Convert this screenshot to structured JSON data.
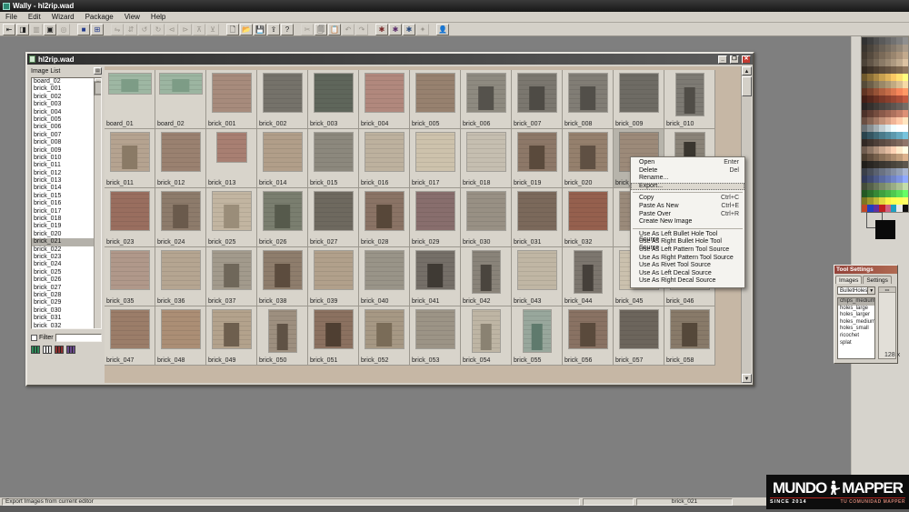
{
  "window": {
    "title": "Wally - hl2rip.wad"
  },
  "menu": {
    "items": [
      "File",
      "Edit",
      "Wizard",
      "Package",
      "View",
      "Help"
    ]
  },
  "toolbar": {
    "groups": [
      [
        {
          "name": "view-list-icon",
          "g": "⇤",
          "en": 1
        },
        {
          "name": "view-thumbs-icon",
          "g": "◨",
          "en": 1
        },
        {
          "name": "view-detail-icon",
          "g": "▥",
          "en": 0
        },
        {
          "name": "view-image-icon",
          "g": "▣",
          "en": 1
        },
        {
          "name": "view-mask-icon",
          "g": "◎",
          "en": 0
        }
      ],
      [
        {
          "name": "palette-view-icon",
          "g": "■",
          "en": 1,
          "c": "#223a8c"
        },
        {
          "name": "grid-view-icon",
          "g": "⊞",
          "en": 1,
          "c": "#223a8c"
        }
      ],
      [
        {
          "name": "flip-h-icon",
          "g": "⇋",
          "en": 0
        },
        {
          "name": "flip-v-icon",
          "g": "⇵",
          "en": 0
        },
        {
          "name": "rotate-l-icon",
          "g": "↺",
          "en": 0
        },
        {
          "name": "rotate-r-icon",
          "g": "↻",
          "en": 0
        },
        {
          "name": "shift-l-icon",
          "g": "⊲",
          "en": 0
        },
        {
          "name": "shift-r-icon",
          "g": "⊳",
          "en": 0
        },
        {
          "name": "shift-u-icon",
          "g": "⊼",
          "en": 0
        },
        {
          "name": "shift-d-icon",
          "g": "⊻",
          "en": 0
        }
      ],
      [
        {
          "name": "new-icon",
          "g": "🗋",
          "en": 1
        },
        {
          "name": "open-icon",
          "g": "📂",
          "en": 1,
          "c": "#a07a10"
        },
        {
          "name": "save-icon",
          "g": "💾",
          "en": 1,
          "c": "#223a8c"
        },
        {
          "name": "import-icon",
          "g": "⇪",
          "en": 1
        },
        {
          "name": "help-icon",
          "g": "?",
          "en": 1
        }
      ],
      [
        {
          "name": "cut-icon",
          "g": "✂",
          "en": 0
        },
        {
          "name": "copy-icon",
          "g": "🗐",
          "en": 1
        },
        {
          "name": "paste-icon",
          "g": "📋",
          "en": 1
        },
        {
          "name": "undo-icon",
          "g": "↶",
          "en": 0
        },
        {
          "name": "redo-icon",
          "g": "↷",
          "en": 0
        }
      ],
      [
        {
          "name": "bullethole-left-icon",
          "g": "✱",
          "en": 1,
          "c": "#7a2a2a"
        },
        {
          "name": "bullethole-right-icon",
          "g": "✱",
          "en": 1,
          "c": "#5a2a6a"
        },
        {
          "name": "decal-tool-icon",
          "g": "✱",
          "en": 1,
          "c": "#2a4a7a"
        },
        {
          "name": "rivet-tool-icon",
          "g": "✦",
          "en": 0
        }
      ],
      [
        {
          "name": "user-icon",
          "g": "👤",
          "en": 1
        }
      ]
    ]
  },
  "child_window": {
    "title": "hl2rip.wad",
    "buttons": {
      "minimize": "_",
      "restore": "❐",
      "close": "✕"
    }
  },
  "image_list": {
    "label": "Image List",
    "selected": "brick_021",
    "filter_label": "Filter",
    "items": [
      "board_02",
      "brick_001",
      "brick_002",
      "brick_003",
      "brick_004",
      "brick_005",
      "brick_006",
      "brick_007",
      "brick_008",
      "brick_009",
      "brick_010",
      "brick_011",
      "brick_012",
      "brick_013",
      "brick_014",
      "brick_015",
      "brick_016",
      "brick_017",
      "brick_018",
      "brick_019",
      "brick_020",
      "brick_021",
      "brick_022",
      "brick_023",
      "brick_024",
      "brick_025",
      "brick_026",
      "brick_027",
      "brick_028",
      "brick_029",
      "brick_030",
      "brick_031",
      "brick_032"
    ],
    "wad_icon_colors": [
      "#2e8b5a",
      "#e8e8e8",
      "#8b2e2e",
      "#6a4a8b"
    ]
  },
  "texture_grid": {
    "rows": [
      [
        {
          "label": "board_01",
          "c": "#9eb7a3",
          "d": "#7d9c86",
          "s": "w"
        },
        {
          "label": "board_02",
          "c": "#9cb5a1",
          "d": "#7d9c86",
          "s": "w"
        },
        {
          "label": "brick_001",
          "c": "#a78b7c",
          "s": "q"
        },
        {
          "label": "brick_002",
          "c": "#75726a",
          "s": "q"
        },
        {
          "label": "brick_003",
          "c": "#5f665b",
          "s": "q"
        },
        {
          "label": "brick_004",
          "c": "#b1887d",
          "s": "q"
        },
        {
          "label": "brick_005",
          "c": "#97816f",
          "s": "q"
        },
        {
          "label": "brick_006",
          "c": "#8e8a80",
          "d": "#55524c",
          "s": "q"
        },
        {
          "label": "brick_007",
          "c": "#7b776f",
          "d": "#4e4b45",
          "s": "q"
        },
        {
          "label": "brick_008",
          "c": "#817d75",
          "d": "#524f49",
          "s": "q"
        },
        {
          "label": "brick_009",
          "c": "#6e6b64",
          "s": "q"
        },
        {
          "label": "brick_010",
          "c": "#7d7a73",
          "d": "#504d47",
          "s": "t"
        }
      ],
      [
        {
          "label": "brick_011",
          "c": "#b5a390",
          "d": "#8a7a66",
          "s": "q"
        },
        {
          "label": "brick_012",
          "c": "#9a8170",
          "s": "q"
        },
        {
          "label": "brick_013",
          "c": "#a87f72",
          "s": "s"
        },
        {
          "label": "brick_014",
          "c": "#b19e89",
          "s": "q"
        },
        {
          "label": "brick_015",
          "c": "#8c887d",
          "s": "q"
        },
        {
          "label": "brick_016",
          "c": "#bdb19e",
          "s": "q"
        },
        {
          "label": "brick_017",
          "c": "#cdc2ac",
          "s": "q"
        },
        {
          "label": "brick_018",
          "c": "#c5beb0",
          "s": "q"
        },
        {
          "label": "brick_019",
          "c": "#8d7868",
          "d": "#5a4a3c",
          "s": "q"
        },
        {
          "label": "brick_020",
          "c": "#95806d",
          "d": "#5f5043",
          "s": "q"
        },
        {
          "label": "brick_021",
          "c": "#9c8a79",
          "s": "q",
          "sel": true
        },
        {
          "label": "brick_022",
          "c": "#8a8378",
          "d": "#3a362f",
          "s": "s"
        }
      ],
      [
        {
          "label": "brick_023",
          "c": "#996e5f",
          "s": "q"
        },
        {
          "label": "brick_024",
          "c": "#8d7b6b",
          "d": "#6a5a4c",
          "s": "q"
        },
        {
          "label": "brick_025",
          "c": "#c2b5a1",
          "d": "#9a8d79",
          "s": "q"
        },
        {
          "label": "brick_026",
          "c": "#7a7e6f",
          "d": "#565a4c",
          "s": "q"
        },
        {
          "label": "brick_027",
          "c": "#6e695f",
          "s": "q"
        },
        {
          "label": "brick_028",
          "c": "#8a7365",
          "d": "#574739",
          "s": "q"
        },
        {
          "label": "brick_029",
          "c": "#886e6d",
          "s": "q"
        },
        {
          "label": "brick_030",
          "c": "#989084",
          "s": "q"
        },
        {
          "label": "brick_031",
          "c": "#7b695b",
          "s": "q"
        },
        {
          "label": "brick_032",
          "c": "#95604e",
          "s": "q"
        },
        {
          "label": "",
          "c": "#9a8a7a",
          "s": "q"
        },
        {
          "label": "",
          "c": "#9a8a7a",
          "s": "q"
        }
      ],
      [
        {
          "label": "brick_035",
          "c": "#b0988a",
          "s": "q"
        },
        {
          "label": "brick_036",
          "c": "#b5a591",
          "s": "q"
        },
        {
          "label": "brick_037",
          "c": "#a29a8c",
          "d": "#6f675a",
          "s": "q"
        },
        {
          "label": "brick_038",
          "c": "#8e7d6c",
          "d": "#5c4c3e",
          "s": "q"
        },
        {
          "label": "brick_039",
          "c": "#b1a08b",
          "s": "q"
        },
        {
          "label": "brick_040",
          "c": "#999488",
          "s": "q"
        },
        {
          "label": "brick_041",
          "c": "#756f68",
          "d": "#3f3a34",
          "s": "q"
        },
        {
          "label": "brick_042",
          "c": "#898379",
          "d": "#4a453e",
          "s": "t"
        },
        {
          "label": "brick_043",
          "c": "#c0b6a4",
          "s": "q"
        },
        {
          "label": "brick_044",
          "c": "#7c766e",
          "d": "#45403a",
          "s": "t"
        },
        {
          "label": "brick_045",
          "c": "#cbc1ae",
          "s": "q"
        },
        {
          "label": "brick_046",
          "c": "#d4cbba",
          "s": "q"
        }
      ],
      [
        {
          "label": "brick_047",
          "c": "#9b7d69",
          "s": "q"
        },
        {
          "label": "brick_048",
          "c": "#ab8e75",
          "s": "q"
        },
        {
          "label": "brick_049",
          "c": "#b3a28c",
          "d": "#6e5f4e",
          "s": "q"
        },
        {
          "label": "brick_050",
          "c": "#9d8f7f",
          "d": "#5f5245",
          "s": "t"
        },
        {
          "label": "brick_051",
          "c": "#8b7160",
          "d": "#4f3f32",
          "s": "q"
        },
        {
          "label": "brick_052",
          "c": "#a69884",
          "d": "#7a6c58",
          "s": "q"
        },
        {
          "label": "brick_053",
          "c": "#9c9486",
          "s": "q"
        },
        {
          "label": "brick_054",
          "c": "#beb5a4",
          "d": "#8a8272",
          "s": "t"
        },
        {
          "label": "brick_055",
          "c": "#98a79c",
          "d": "#5f7a6d",
          "s": "t"
        },
        {
          "label": "brick_056",
          "c": "#897263",
          "d": "#5a4a3c",
          "s": "q"
        },
        {
          "label": "brick_057",
          "c": "#6c655c",
          "s": "q"
        },
        {
          "label": "brick_058",
          "c": "#887a69",
          "d": "#55483a",
          "s": "q"
        }
      ]
    ]
  },
  "context_menu": {
    "items": [
      {
        "label": "Open",
        "shortcut": "Enter"
      },
      {
        "label": "Delete",
        "shortcut": "Del"
      },
      {
        "label": "Rename..."
      },
      {
        "label": "Export...",
        "highlighted": true
      },
      {
        "sep": true
      },
      {
        "label": "Copy",
        "shortcut": "Ctrl+C"
      },
      {
        "label": "Paste As New",
        "shortcut": "Ctrl+E"
      },
      {
        "label": "Paste Over",
        "shortcut": "Ctrl+R"
      },
      {
        "label": "Create New Image"
      },
      {
        "sep": true
      },
      {
        "label": "Use As Left Bullet Hole Tool Source"
      },
      {
        "label": "Use As Right Bullet Hole Tool Source"
      },
      {
        "label": "Use As Left Pattern Tool Source"
      },
      {
        "label": "Use As Right Pattern Tool Source"
      },
      {
        "label": "Use As Rivet Tool Source"
      },
      {
        "label": "Use As Left Decal Source"
      },
      {
        "label": "Use As Right Decal Source"
      }
    ]
  },
  "palette": {
    "row_bases": [
      "#5a5a5a",
      "#6a6156",
      "#7a6a58",
      "#8a7a66",
      "#5a4a3a",
      "#c8a050",
      "#9a8868",
      "#b06040",
      "#7a3828",
      "#4a4440",
      "#8a5a4a",
      "#c09078",
      "#c2ced2",
      "#4a7a8a",
      "#5a4a42",
      "#caa890",
      "#8a7058",
      "#3a3630",
      "#6a7282",
      "#5a6aa0",
      "#7a8a6a",
      "#40a040",
      "#e0d840"
    ],
    "last_row": [
      "#c04828",
      "#2040c0",
      "#6030a0",
      "#c02020",
      "#d06080",
      "#20a0c0",
      "#e8e8e8",
      "#101010"
    ]
  },
  "tool_settings": {
    "title": "Tool Settings",
    "tabs": [
      "Images",
      "Settings"
    ],
    "dropdown_value": "BulletHoles",
    "items": [
      "chips_medium",
      "holes_large",
      "holes_larger",
      "holes_medium",
      "holes_small",
      "ricochet",
      "splat"
    ],
    "selected": "chips_medium",
    "size_label": "128 x"
  },
  "status_bar": {
    "message": "Export Images from current editor",
    "selected_texture": "brick_021"
  },
  "logo": {
    "word1": "MUNDO",
    "word2": "MAPPER",
    "sub_left": "SINCE 2014",
    "sub_right": "TU COMUNIDAD MAPPER"
  }
}
